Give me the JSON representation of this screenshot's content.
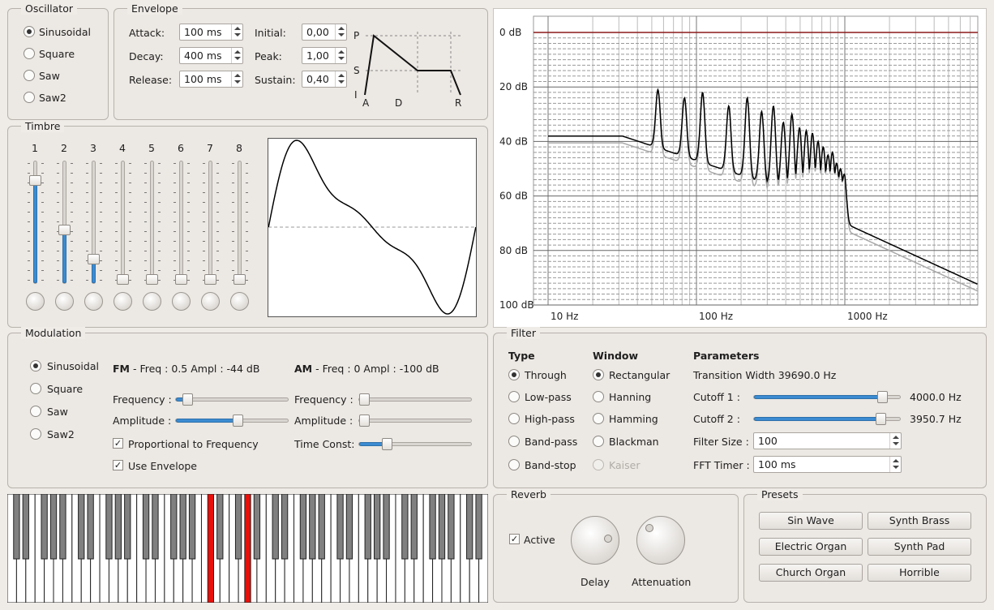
{
  "oscillator": {
    "title": "Oscillator",
    "options": [
      "Sinusoidal",
      "Square",
      "Saw",
      "Saw2"
    ],
    "selected": 0
  },
  "envelope": {
    "title": "Envelope",
    "attack_label": "Attack:",
    "attack": "100 ms",
    "decay_label": "Decay:",
    "decay": "400 ms",
    "release_label": "Release:",
    "release": "100 ms",
    "initial_label": "Initial:",
    "initial": "0,00",
    "peak_label": "Peak:",
    "peak": "1,00",
    "sustain_label": "Sustain:",
    "sustain": "0,40",
    "graph_labels": {
      "p": "P",
      "s": "S",
      "i": "I",
      "a": "A",
      "d": "D",
      "r": "R"
    }
  },
  "timbre": {
    "title": "Timbre",
    "harmonics": [
      "1",
      "2",
      "3",
      "4",
      "5",
      "6",
      "7",
      "8"
    ],
    "levels": [
      0.88,
      0.44,
      0.18,
      0,
      0,
      0,
      0,
      0
    ]
  },
  "spectrum": {
    "y_labels": [
      "0 dB",
      "20 dB",
      "40 dB",
      "60 dB",
      "80 dB",
      "100 dB"
    ],
    "x_labels": [
      "10 Hz",
      "100 Hz",
      "1000 Hz"
    ],
    "colors": {
      "line": "#000000",
      "shadow": "#a9a9a9",
      "reference": "#8b1a1a"
    }
  },
  "modulation": {
    "title": "Modulation",
    "options": [
      "Sinusoidal",
      "Square",
      "Saw",
      "Saw2"
    ],
    "selected": 0,
    "fm_prefix": "FM",
    "fm_info": " - Freq : 0.5 Ampl : -44 dB",
    "am_prefix": "AM",
    "am_info": " - Freq : 0 Ampl : -100 dB",
    "frequency_label": "Frequency :",
    "amplitude_label": "Amplitude :",
    "time_const_label": "Time Const:",
    "proportional_label": "Proportional to Frequency",
    "proportional_checked": "✓",
    "use_envelope_label": "Use Envelope",
    "use_envelope_checked": "✓",
    "fm_frequency": 0.06,
    "fm_amplitude": 0.56,
    "am_frequency": 0,
    "am_amplitude": 0,
    "time_const": 0.22
  },
  "filter": {
    "title": "Filter",
    "type_header": "Type",
    "types": [
      "Through",
      "Low-pass",
      "High-pass",
      "Band-pass",
      "Band-stop"
    ],
    "type_selected": 0,
    "window_header": "Window",
    "windows": [
      "Rectangular",
      "Hanning",
      "Hamming",
      "Blackman",
      "Kaiser"
    ],
    "window_selected": 0,
    "params_header": "Parameters",
    "transition": "Transition Width 39690.0 Hz",
    "cutoff1_label": "Cutoff 1 :",
    "cutoff1_value": "4000.0 Hz",
    "cutoff1_level": 0.91,
    "cutoff2_label": "Cutoff 2 :",
    "cutoff2_value": "3950.7 Hz",
    "cutoff2_level": 0.9,
    "filter_size_label": "Filter Size :",
    "filter_size": "100",
    "fft_timer_label": "FFT Timer :",
    "fft_timer": "100 ms"
  },
  "reverb": {
    "title": "Reverb",
    "active_label": "Active",
    "active_checked": "✓",
    "delay_label": "Delay",
    "attenuation_label": "Attenuation"
  },
  "presets": {
    "title": "Presets",
    "buttons": [
      "Sin Wave",
      "Synth Brass",
      "Electric Organ",
      "Synth Pad",
      "Church Organ",
      "Horrible"
    ]
  },
  "keyboard": {
    "white_keys": 52,
    "pressed_black_keys": [
      15,
      18
    ],
    "pressed_color": "#e8100a"
  }
}
